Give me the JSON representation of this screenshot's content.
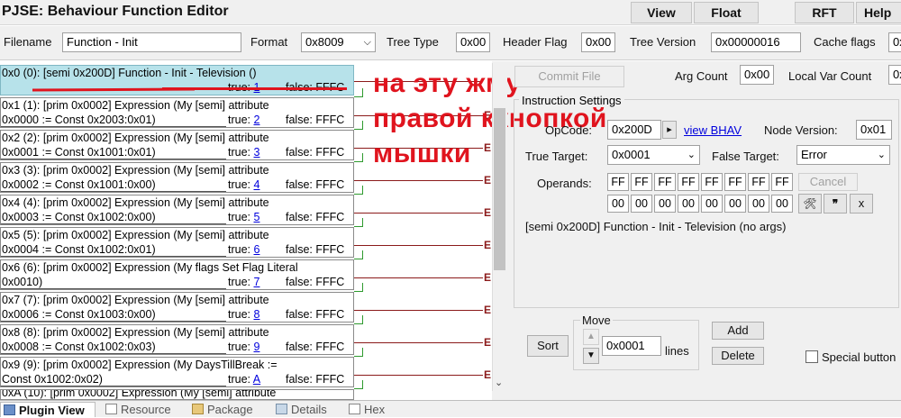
{
  "window": {
    "title": "PJSE: Behaviour Function Editor",
    "buttons": {
      "view": "View",
      "float": "Float",
      "rft": "RFT",
      "help": "Help"
    }
  },
  "header": {
    "filename_label": "Filename",
    "filename_value": "Function - Init",
    "format_label": "Format",
    "format_value": "0x8009",
    "tree_type_label": "Tree Type",
    "tree_type_value": "0x00",
    "header_flag_label": "Header Flag",
    "header_flag_value": "0x00",
    "tree_version_label": "Tree Version",
    "tree_version_value": "0x00000016",
    "cache_flags_label": "Cache flags",
    "cache_flags_value": "0x"
  },
  "tree": {
    "nodes": [
      {
        "l1": "0x0 (0): [semi 0x200D] Function - Init - Television ()",
        "l2": "",
        "true_label": "true: ",
        "true_val": "1",
        "false": "false: FFFC",
        "selected": true
      },
      {
        "l1": "0x1 (1): [prim 0x0002] Expression (My [semi] attribute",
        "l2": "0x0000 := Const 0x2003:0x01)",
        "true_label": "true: ",
        "true_val": "2",
        "false": "false: FFFC"
      },
      {
        "l1": "0x2 (2): [prim 0x0002] Expression (My [semi] attribute",
        "l2": "0x0001 := Const 0x1001:0x01)",
        "true_label": "true: ",
        "true_val": "3",
        "false": "false: FFFC"
      },
      {
        "l1": "0x3 (3): [prim 0x0002] Expression (My [semi] attribute",
        "l2": "0x0002 := Const 0x1001:0x00)",
        "true_label": "true: ",
        "true_val": "4",
        "false": "false: FFFC"
      },
      {
        "l1": "0x4 (4): [prim 0x0002] Expression (My [semi] attribute",
        "l2": "0x0003 := Const 0x1002:0x00)",
        "true_label": "true: ",
        "true_val": "5",
        "false": "false: FFFC"
      },
      {
        "l1": "0x5 (5): [prim 0x0002] Expression (My [semi] attribute",
        "l2": "0x0004 := Const 0x1002:0x01)",
        "true_label": "true: ",
        "true_val": "6",
        "false": "false: FFFC"
      },
      {
        "l1": "0x6 (6): [prim 0x0002] Expression (My flags Set Flag Literal",
        "l2": "0x0010)",
        "true_label": "true: ",
        "true_val": "7",
        "false": "false: FFFC"
      },
      {
        "l1": "0x7 (7): [prim 0x0002] Expression (My [semi] attribute",
        "l2": "0x0006 := Const 0x1003:0x00)",
        "true_label": "true: ",
        "true_val": "8",
        "false": "false: FFFC"
      },
      {
        "l1": "0x8 (8): [prim 0x0002] Expression (My [semi] attribute",
        "l2": "0x0008 := Const 0x1002:0x03)",
        "true_label": "true: ",
        "true_val": "9",
        "false": "false: FFFC"
      },
      {
        "l1": "0x9 (9): [prim 0x0002] Expression (My DaysTillBreak :=",
        "l2": "Const 0x1002:0x02)",
        "true_label": "true: ",
        "true_val": "A",
        "false": "false: FFFC"
      }
    ],
    "partial_node": "0xA (10): [prim 0x0002] Expression (My [semi] attribute",
    "error_marker": "E"
  },
  "annotation": {
    "line1": "на эту жму",
    "line2": "правой ккнопкой",
    "line3": "мышки",
    "color": "#e0141e"
  },
  "panel": {
    "commit_file": "Commit File",
    "arg_count_label": "Arg Count",
    "arg_count_value": "0x00",
    "local_var_label": "Local Var Count",
    "local_var_value": "0x",
    "instruction_settings": "Instruction Settings",
    "opcode_label": "OpCode:",
    "opcode_value": "0x200D",
    "opcode_btn": "▸",
    "view_bhav": "view BHAV",
    "node_version_label": "Node Version:",
    "node_version_value": "0x01",
    "true_target_label": "True Target:",
    "true_target_value": "0x0001",
    "false_target_label": "False Target:",
    "false_target_value": "Error",
    "operands_label": "Operands:",
    "operands_row1": [
      "FF",
      "FF",
      "FF",
      "FF",
      "FF",
      "FF",
      "FF",
      "FF"
    ],
    "operands_row2": [
      "00",
      "00",
      "00",
      "00",
      "00",
      "00",
      "00",
      "00"
    ],
    "cancel": "Cancel",
    "tool_btn": "🛠",
    "quote_btn": "❞",
    "x_btn": "x",
    "description": "[semi 0x200D] Function - Init - Television (no args)",
    "move_label": "Move",
    "move_value": "0x0001",
    "lines_label": "lines",
    "sort": "Sort",
    "add": "Add",
    "delete": "Delete",
    "special_button": "Special button"
  },
  "tabs": {
    "plugin_view": "Plugin View",
    "resource": "Resource",
    "package": "Package",
    "details": "Details",
    "hex": "Hex"
  },
  "icons": {
    "up": "arrow-up-icon",
    "down": "arrow-down-icon",
    "dropdown": "chevron-down-icon"
  }
}
